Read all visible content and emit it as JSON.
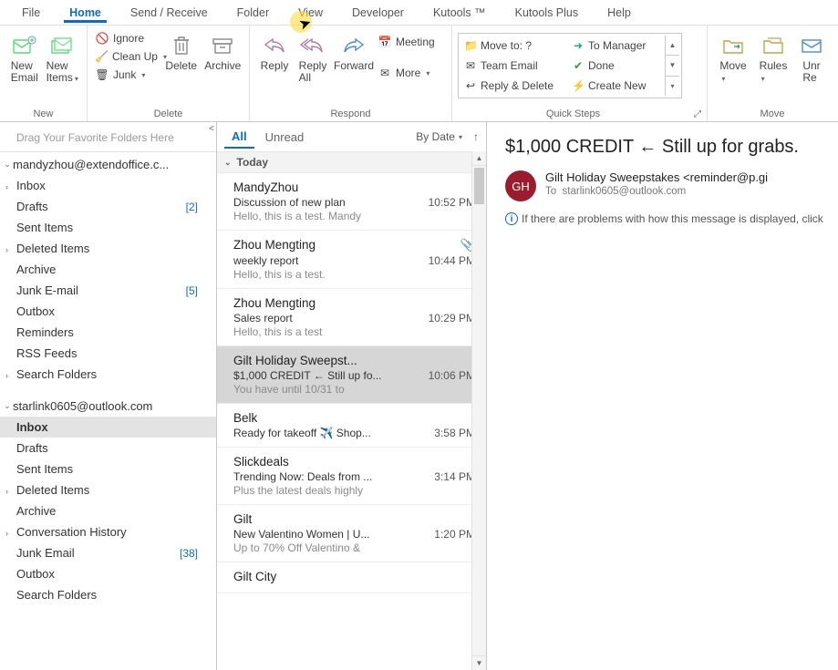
{
  "tabs": [
    "File",
    "Home",
    "Send / Receive",
    "Folder",
    "View",
    "Developer",
    "Kutools ™",
    "Kutools Plus",
    "Help"
  ],
  "active_tab": "Home",
  "ribbon": {
    "new": {
      "label": "New",
      "new_email": "New Email",
      "new_items": "New Items"
    },
    "delete": {
      "label": "Delete",
      "ignore": "Ignore",
      "cleanup": "Clean Up",
      "junk": "Junk",
      "delete": "Delete",
      "archive": "Archive"
    },
    "respond": {
      "label": "Respond",
      "reply": "Reply",
      "reply_all": "Reply All",
      "forward": "Forward",
      "meeting": "Meeting",
      "more": "More"
    },
    "quicksteps": {
      "label": "Quick Steps",
      "c11": "Move to: ?",
      "c12": "To Manager",
      "c21": "Team Email",
      "c22": "Done",
      "c31": "Reply & Delete",
      "c32": "Create New"
    },
    "move": {
      "label": "Move",
      "move": "Move",
      "rules": "Rules",
      "unread": "Unr Re"
    }
  },
  "sidebar": {
    "favhint": "Drag Your Favorite Folders Here",
    "accounts": [
      {
        "name": "mandyzhou@extendoffice.c...",
        "expanded": true,
        "folders": [
          {
            "name": "Inbox",
            "expandable": true
          },
          {
            "name": "Drafts",
            "count": "[2]"
          },
          {
            "name": "Sent Items"
          },
          {
            "name": "Deleted Items",
            "expandable": true
          },
          {
            "name": "Archive"
          },
          {
            "name": "Junk E-mail",
            "count": "[5]"
          },
          {
            "name": "Outbox"
          },
          {
            "name": "Reminders"
          },
          {
            "name": "RSS Feeds"
          },
          {
            "name": "Search Folders",
            "expandable": true
          }
        ]
      },
      {
        "name": "starlink0605@outlook.com",
        "expanded": true,
        "folders": [
          {
            "name": "Inbox",
            "selected": true
          },
          {
            "name": "Drafts"
          },
          {
            "name": "Sent Items"
          },
          {
            "name": "Deleted Items",
            "expandable": true
          },
          {
            "name": "Archive"
          },
          {
            "name": "Conversation History",
            "expandable": true
          },
          {
            "name": "Junk Email",
            "count": "[38]"
          },
          {
            "name": "Outbox"
          },
          {
            "name": "Search Folders"
          }
        ]
      }
    ]
  },
  "list": {
    "filter_all": "All",
    "filter_unread": "Unread",
    "sort": "By Date",
    "group": "Today",
    "messages": [
      {
        "from": "MandyZhou",
        "subject": "Discussion of new plan",
        "preview": "Hello, this is a test.  Mandy",
        "time": "10:52 PM"
      },
      {
        "from": "Zhou Mengting",
        "subject": "weekly report",
        "preview": "Hello, this is a test. <end>",
        "time": "10:44 PM",
        "attachment": true
      },
      {
        "from": "Zhou Mengting",
        "subject": "Sales report",
        "preview": "Hello, this is a test <end>",
        "time": "10:29 PM"
      },
      {
        "from": "Gilt Holiday Sweepst...",
        "subject": "$1,000 CREDIT ← Still up fo...",
        "preview": "You have until 10/31 to",
        "time": "10:06 PM",
        "selected": true
      },
      {
        "from": "Belk",
        "subject": "Ready for takeoff ✈️ Shop...",
        "preview": "",
        "time": "3:58 PM"
      },
      {
        "from": "Slickdeals",
        "subject": "Trending Now: Deals from ...",
        "preview": "Plus the latest deals highly",
        "time": "3:14 PM"
      },
      {
        "from": "Gilt",
        "subject": "New Valentino Women | U...",
        "preview": "Up to 70% Off Valentino &",
        "time": "1:20 PM"
      },
      {
        "from": "Gilt City",
        "subject": "",
        "preview": "",
        "time": ""
      }
    ]
  },
  "reading": {
    "subject": "$1,000 CREDIT ← Still up for grabs.",
    "avatar": "GH",
    "from": "Gilt Holiday Sweepstakes <reminder@p.gi",
    "to_label": "To",
    "to": "starlink0605@outlook.com",
    "info": "If there are problems with how this message is displayed, click"
  }
}
